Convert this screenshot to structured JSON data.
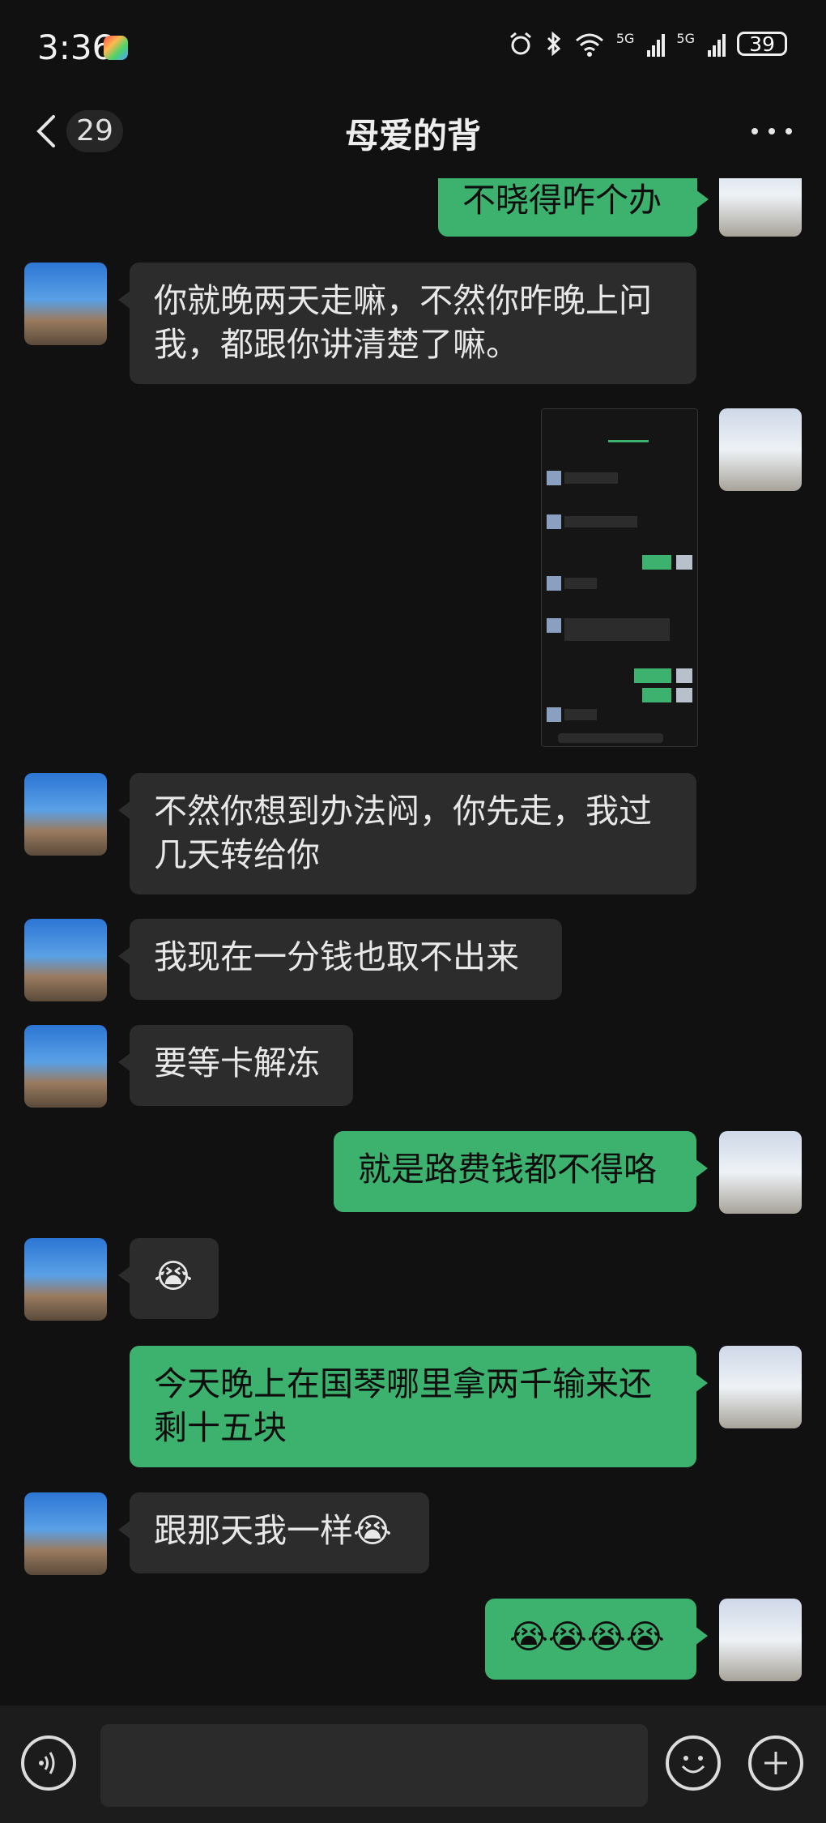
{
  "status_bar": {
    "time": "3:36",
    "battery": "39",
    "network_tag": "5G"
  },
  "header": {
    "unread_count": "29",
    "title": "母爱的背"
  },
  "messages": [
    {
      "sender": "me",
      "type": "text",
      "text": "不晓得咋个办"
    },
    {
      "sender": "other",
      "type": "text",
      "text": "你就晚两天走嘛，不然你昨晚上问我，都跟你讲清楚了嘛。"
    },
    {
      "sender": "me",
      "type": "image",
      "text": ""
    },
    {
      "sender": "other",
      "type": "text",
      "text": "不然你想到办法闷，你先走，我过几天转给你"
    },
    {
      "sender": "other",
      "type": "text",
      "text": "我现在一分钱也取不出来"
    },
    {
      "sender": "other",
      "type": "text",
      "text": "要等卡解冻"
    },
    {
      "sender": "me",
      "type": "text",
      "text": "就是路费钱都不得咯"
    },
    {
      "sender": "other",
      "type": "emoji",
      "text": "😭"
    },
    {
      "sender": "me",
      "type": "text",
      "text": "今天晚上在国琴哪里拿两千输来还剩十五块"
    },
    {
      "sender": "other",
      "type": "text",
      "text": "跟那天我一样😭"
    },
    {
      "sender": "me",
      "type": "text",
      "text": "😭😭😭😭"
    }
  ],
  "input": {
    "placeholder": ""
  },
  "colors": {
    "self_bubble": "#3db26f",
    "other_bubble": "#2c2c2c",
    "background": "#111111"
  }
}
